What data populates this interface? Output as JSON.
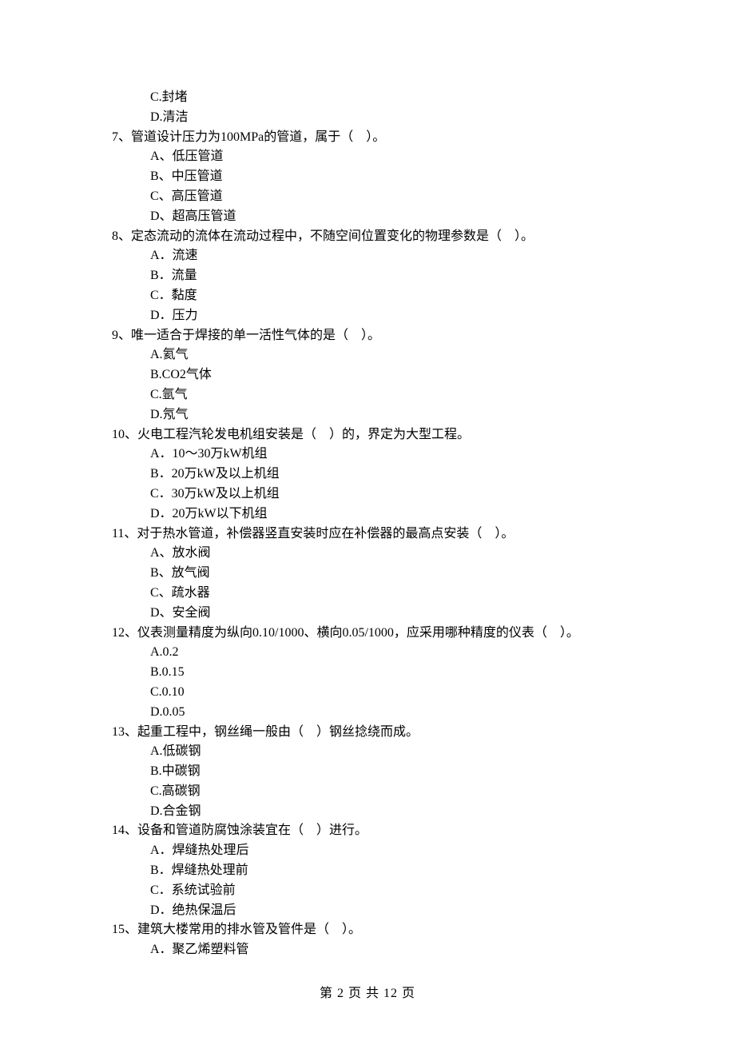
{
  "pre_options": [
    "C.封堵",
    "D.清洁"
  ],
  "questions": [
    {
      "stem": "7、管道设计压力为100MPa的管道，属于（    ）。",
      "options": [
        "A、低压管道",
        "B、中压管道",
        "C、高压管道",
        "D、超高压管道"
      ]
    },
    {
      "stem": "8、定态流动的流体在流动过程中，不随空间位置变化的物理参数是（    ）。",
      "options": [
        "A．流速",
        "B．流量",
        "C．黏度",
        "D．压力"
      ]
    },
    {
      "stem": "9、唯一适合于焊接的单一活性气体的是（    ）。",
      "options": [
        "A.氦气",
        "B.CO2气体",
        "C.氩气",
        "D.氖气"
      ]
    },
    {
      "stem": "10、火电工程汽轮发电机组安装是（    ）的，界定为大型工程。",
      "options": [
        "A．10～30万kW机组",
        "B．20万kW及以上机组",
        "C．30万kW及以上机组",
        "D．20万kW以下机组"
      ]
    },
    {
      "stem": "11、对于热水管道，补偿器竖直安装时应在补偿器的最高点安装（    ）。",
      "options": [
        "A、放水阀",
        "B、放气阀",
        "C、疏水器",
        "D、安全阀"
      ]
    },
    {
      "stem": "12、仪表测量精度为纵向0.10/1000、横向0.05/1000，应采用哪种精度的仪表（    ）。",
      "options": [
        "A.0.2",
        "B.0.15",
        "C.0.10",
        "D.0.05"
      ]
    },
    {
      "stem": "13、起重工程中，钢丝绳一般由（    ）钢丝捻绕而成。",
      "options": [
        "A.低碳钢",
        "B.中碳钢",
        "C.高碳钢",
        "D.合金钢"
      ]
    },
    {
      "stem": "14、设备和管道防腐蚀涂装宜在（    ）进行。",
      "options": [
        "A．焊缝热处理后",
        "B．焊缝热处理前",
        "C．系统试验前",
        "D．绝热保温后"
      ]
    },
    {
      "stem": "15、建筑大楼常用的排水管及管件是（    ）。",
      "options": [
        "A．聚乙烯塑料管"
      ]
    }
  ],
  "footer": "第 2 页 共 12 页"
}
